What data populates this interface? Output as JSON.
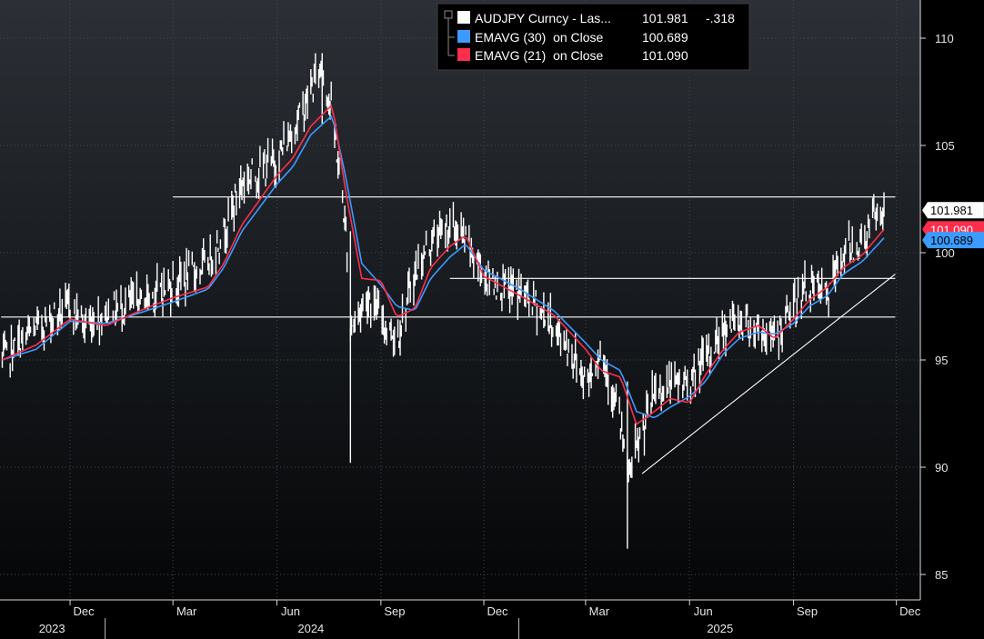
{
  "legend": {
    "title_series": {
      "name": "AUDJPY Curncy - Las...",
      "value": "101.981",
      "change": "-.318",
      "color": "#ffffff"
    },
    "ema30": {
      "name": "EMAVG (30)  on Close",
      "value": "100.689",
      "color": "#3c9bff"
    },
    "ema21": {
      "name": "EMAVG (21)  on Close",
      "value": "101.090",
      "color": "#ff2e4d"
    }
  },
  "badges": {
    "last": {
      "text": "101.981",
      "bg": "#ffffff",
      "fg": "#000000"
    },
    "ema21": {
      "text": "101.090",
      "bg": "#ff2e4d",
      "fg": "#ffffff"
    },
    "ema30": {
      "text": "100.689",
      "bg": "#3c9bff",
      "fg": "#000000"
    }
  },
  "chart_data": {
    "type": "line",
    "title": "",
    "ylim": [
      84,
      111.5
    ],
    "y_ticks": [
      85,
      90,
      95,
      100,
      105,
      110
    ],
    "x_month_labels": [
      "Dec",
      "Mar",
      "Jun",
      "Sep",
      "Dec",
      "Mar",
      "Jun",
      "Sep",
      "Dec"
    ],
    "x_year_labels": [
      "2023",
      "2024",
      "2025"
    ],
    "series": [
      {
        "name": "AUDJPY Curncy - Las...",
        "color": "#ffffff",
        "style": "bars",
        "x": [
          "2023-10-02",
          "2023-11-01",
          "2023-12-01",
          "2023-12-15",
          "2024-01-02",
          "2024-02-01",
          "2024-03-01",
          "2024-04-01",
          "2024-04-15",
          "2024-05-01",
          "2024-06-01",
          "2024-06-15",
          "2024-07-01",
          "2024-07-10",
          "2024-07-20",
          "2024-08-01",
          "2024-08-05",
          "2024-08-20",
          "2024-09-01",
          "2024-09-15",
          "2024-10-01",
          "2024-10-15",
          "2024-11-01",
          "2024-11-15",
          "2024-12-01",
          "2024-12-15",
          "2025-01-02",
          "2025-01-15",
          "2025-02-01",
          "2025-02-15",
          "2025-03-01",
          "2025-03-15",
          "2025-04-01",
          "2025-04-07",
          "2025-04-20",
          "2025-05-01",
          "2025-05-15",
          "2025-06-01",
          "2025-06-15",
          "2025-07-01",
          "2025-07-15",
          "2025-08-01",
          "2025-08-15",
          "2025-09-01",
          "2025-09-15",
          "2025-10-01",
          "2025-10-15",
          "2025-11-01",
          "2025-11-10",
          "2025-11-20"
        ],
        "values": [
          95.0,
          96.5,
          97.5,
          96.6,
          97.2,
          97.8,
          98.5,
          99.5,
          101.0,
          103.3,
          104.3,
          105.7,
          107.5,
          108.8,
          106.5,
          101.0,
          96.5,
          98.0,
          97.0,
          96.0,
          99.0,
          100.5,
          101.3,
          100.5,
          99.0,
          98.4,
          98.2,
          97.7,
          96.5,
          95.5,
          94.0,
          95.5,
          92.0,
          89.5,
          91.5,
          93.5,
          93.8,
          94.0,
          95.0,
          96.5,
          96.8,
          96.5,
          96.0,
          97.5,
          98.5,
          98.0,
          100.0,
          100.5,
          101.5,
          101.981
        ]
      },
      {
        "name": "EMAVG (30)  on Close",
        "color": "#3c9bff",
        "style": "line",
        "x": [
          "2023-10-02",
          "2023-11-01",
          "2023-12-01",
          "2024-01-02",
          "2024-02-01",
          "2024-03-01",
          "2024-04-01",
          "2024-04-15",
          "2024-05-01",
          "2024-06-01",
          "2024-06-15",
          "2024-07-01",
          "2024-07-20",
          "2024-08-01",
          "2024-08-15",
          "2024-09-01",
          "2024-09-15",
          "2024-10-01",
          "2024-10-15",
          "2024-11-01",
          "2024-11-15",
          "2024-12-01",
          "2025-01-02",
          "2025-02-01",
          "2025-03-01",
          "2025-03-15",
          "2025-04-01",
          "2025-04-15",
          "2025-05-01",
          "2025-05-15",
          "2025-06-01",
          "2025-06-15",
          "2025-07-01",
          "2025-07-15",
          "2025-08-01",
          "2025-08-15",
          "2025-09-01",
          "2025-09-15",
          "2025-10-01",
          "2025-10-15",
          "2025-11-01",
          "2025-11-20"
        ],
        "values": [
          95.0,
          95.5,
          96.8,
          96.7,
          97.2,
          97.7,
          98.3,
          99.3,
          101.0,
          103.2,
          104.0,
          105.5,
          106.4,
          103.5,
          99.5,
          98.5,
          97.5,
          97.3,
          98.8,
          99.8,
          100.4,
          99.2,
          98.3,
          97.3,
          95.8,
          95.0,
          94.5,
          92.6,
          92.3,
          92.8,
          93.3,
          94.0,
          95.3,
          96.0,
          96.3,
          96.2,
          96.7,
          97.5,
          98.0,
          99.0,
          99.6,
          100.689
        ]
      },
      {
        "name": "EMAVG (21)  on Close",
        "color": "#ff2e4d",
        "style": "line",
        "x": [
          "2023-10-02",
          "2023-11-01",
          "2023-12-01",
          "2024-01-02",
          "2024-02-01",
          "2024-03-01",
          "2024-04-01",
          "2024-04-15",
          "2024-05-01",
          "2024-06-01",
          "2024-06-15",
          "2024-07-01",
          "2024-07-20",
          "2024-08-01",
          "2024-08-15",
          "2024-09-01",
          "2024-09-15",
          "2024-10-01",
          "2024-10-15",
          "2024-11-01",
          "2024-11-15",
          "2024-12-01",
          "2025-01-02",
          "2025-02-01",
          "2025-03-01",
          "2025-03-15",
          "2025-04-01",
          "2025-04-15",
          "2025-05-01",
          "2025-05-15",
          "2025-06-01",
          "2025-06-15",
          "2025-07-01",
          "2025-07-15",
          "2025-08-01",
          "2025-08-15",
          "2025-09-01",
          "2025-09-15",
          "2025-10-01",
          "2025-10-15",
          "2025-11-01",
          "2025-11-20"
        ],
        "values": [
          95.0,
          95.7,
          96.9,
          96.6,
          97.3,
          97.9,
          98.4,
          99.5,
          101.3,
          103.6,
          104.4,
          105.9,
          106.9,
          102.8,
          98.8,
          98.7,
          97.0,
          97.4,
          99.3,
          100.3,
          100.8,
          98.9,
          98.0,
          97.1,
          95.5,
          94.5,
          94.2,
          92.0,
          92.6,
          93.2,
          93.0,
          94.3,
          95.5,
          96.3,
          96.6,
          96.0,
          96.9,
          97.8,
          98.4,
          99.3,
          99.9,
          101.09
        ]
      }
    ],
    "annotations": [
      {
        "type": "hline",
        "y": 102.6,
        "from": "2024-03-01",
        "to": "2025-11-30",
        "color": "#ffffff"
      },
      {
        "type": "hline",
        "y": 98.8,
        "from": "2024-11-01",
        "to": "2025-11-30",
        "color": "#ffffff"
      },
      {
        "type": "hline",
        "y": 97.0,
        "from": "2023-10-01",
        "to": "2025-11-30",
        "color": "#ffffff"
      },
      {
        "type": "trendline",
        "x": [
          "2025-04-20",
          "2025-11-30"
        ],
        "y": [
          89.7,
          99.0
        ],
        "color": "#ffffff"
      }
    ]
  }
}
